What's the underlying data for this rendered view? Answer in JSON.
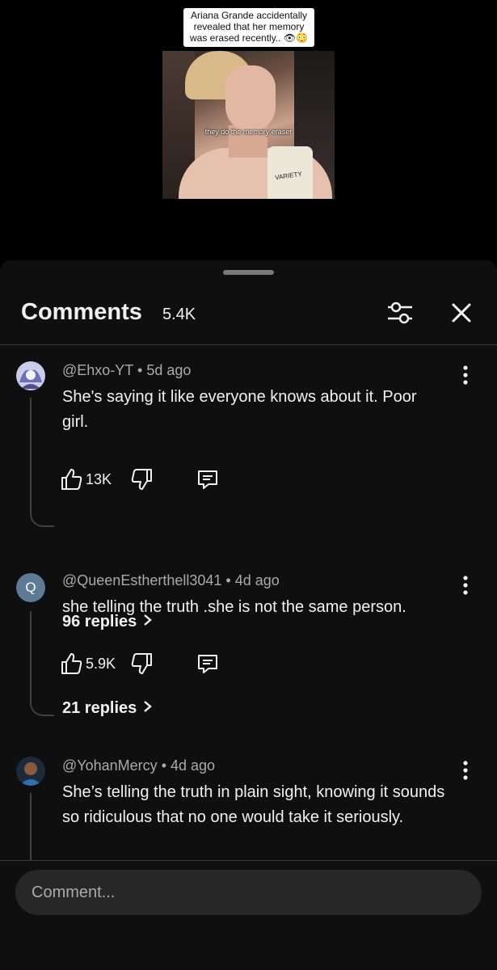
{
  "video": {
    "caption": "Ariana Grande accidentally revealed that her memory was erased recently.. 👁😳",
    "subtitle": "they do the memory eraser",
    "mic_label": "VARIETY"
  },
  "comments_panel": {
    "title": "Comments",
    "count": "5.4K",
    "filter_icon": "sliders-icon",
    "close_icon": "close-icon"
  },
  "comments": [
    {
      "author": "@Ehxo-YT",
      "time": "5d ago",
      "text": "She's saying it like everyone knows about it. Poor girl.",
      "likes": "13K",
      "replies": "96 replies"
    },
    {
      "author": "@QueenEstherthell3041",
      "time": "4d ago",
      "avatar_letter": "Q",
      "text": "she telling the truth .she is not the same person.",
      "likes": "5.9K",
      "replies": "21 replies"
    },
    {
      "author": "@YohanMercy",
      "time": "4d ago",
      "text": "She’s telling the truth in plain sight, knowing it sounds so ridiculous that no one would take it seriously."
    }
  ],
  "input": {
    "placeholder": "Comment..."
  },
  "colors": {
    "sheet_bg": "#0f0f0f",
    "avatar_q": "#5f7a96",
    "meta_text": "#aaaaaa",
    "input_bg": "#272727"
  }
}
